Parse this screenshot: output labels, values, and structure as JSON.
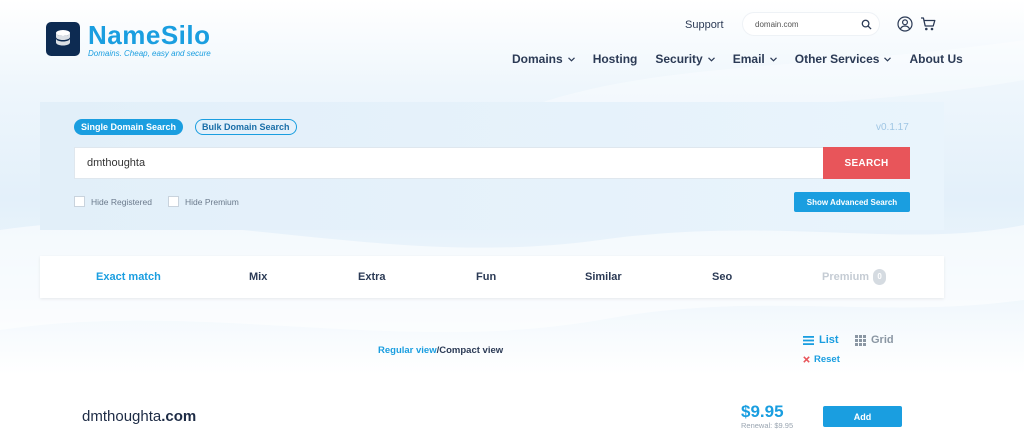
{
  "brand": {
    "name": "NameSilo",
    "tagline": "Domains. Cheap, easy and secure"
  },
  "header": {
    "support_label": "Support",
    "search_placeholder": "domain.com"
  },
  "nav": {
    "items": [
      {
        "label": "Domains",
        "has_dropdown": true
      },
      {
        "label": "Hosting",
        "has_dropdown": false
      },
      {
        "label": "Security",
        "has_dropdown": true
      },
      {
        "label": "Email",
        "has_dropdown": true
      },
      {
        "label": "Other Services",
        "has_dropdown": true
      },
      {
        "label": "About Us",
        "has_dropdown": false
      }
    ]
  },
  "search": {
    "tabs": [
      {
        "label": "Single Domain Search",
        "active": true
      },
      {
        "label": "Bulk Domain Search",
        "active": false
      }
    ],
    "version": "v0.1.17",
    "query": "dmthoughta",
    "button_label": "SEARCH",
    "filters": [
      {
        "label": "Hide Registered",
        "checked": false
      },
      {
        "label": "Hide Premium",
        "checked": false
      }
    ],
    "advanced_label": "Show Advanced Search"
  },
  "categories": [
    {
      "label": "Exact match",
      "state": "active"
    },
    {
      "label": "Mix",
      "state": "normal"
    },
    {
      "label": "Extra",
      "state": "normal"
    },
    {
      "label": "Fun",
      "state": "normal"
    },
    {
      "label": "Similar",
      "state": "normal"
    },
    {
      "label": "Seo",
      "state": "normal"
    },
    {
      "label": "Premium",
      "state": "disabled",
      "badge": "0"
    }
  ],
  "view": {
    "regular_label": "Regular view",
    "separator": "/",
    "compact_label": "Compact view",
    "list_label": "List",
    "grid_label": "Grid",
    "reset_label": "Reset"
  },
  "result": {
    "domain_name": "dmthoughta",
    "tld": ".com",
    "price": "$9.95",
    "renewal": "Renewal: $9.95",
    "add_label": "Add"
  },
  "colors": {
    "brand_blue": "#1a9ee0",
    "navy": "#0d2b52",
    "search_red": "#e8555a",
    "text_dark": "#2b3a55"
  }
}
